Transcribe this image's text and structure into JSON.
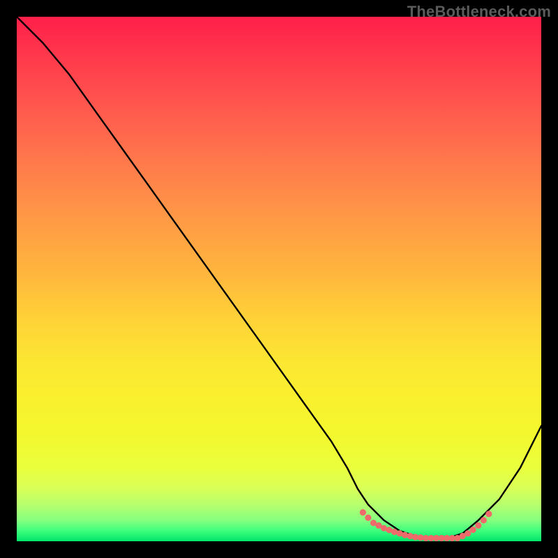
{
  "watermark": "TheBottleneck.com",
  "chart_data": {
    "type": "line",
    "title": "",
    "xlabel": "",
    "ylabel": "",
    "xlim": [
      0,
      100
    ],
    "ylim": [
      0,
      100
    ],
    "grid": false,
    "series": [
      {
        "name": "bottleneck-curve",
        "color": "#000000",
        "x": [
          0,
          5,
          10,
          15,
          20,
          25,
          30,
          35,
          40,
          45,
          50,
          55,
          60,
          63,
          65,
          67,
          70,
          73,
          76,
          79,
          82,
          85,
          88,
          92,
          96,
          100
        ],
        "y": [
          100,
          95,
          89,
          82,
          75,
          68,
          61,
          54,
          47,
          40,
          33,
          26,
          19,
          14,
          10,
          7,
          4,
          2,
          1,
          0.5,
          0.5,
          1.5,
          4,
          8,
          14,
          22
        ]
      },
      {
        "name": "optimal-range-marker",
        "color": "#ef6a6a",
        "style": "dotted-thick",
        "x": [
          66,
          68,
          70,
          72,
          74,
          76,
          78,
          80,
          82,
          84,
          85,
          86,
          87,
          88,
          89,
          90
        ],
        "y": [
          5.5,
          3.5,
          2.5,
          1.8,
          1.2,
          0.8,
          0.6,
          0.6,
          0.6,
          0.6,
          1.0,
          1.5,
          2.2,
          3.0,
          4.0,
          5.2
        ]
      }
    ],
    "gradient_stops": [
      {
        "pos": 0.0,
        "color": "#ff1f4a"
      },
      {
        "pos": 0.18,
        "color": "#ff5a4e"
      },
      {
        "pos": 0.38,
        "color": "#ff9846"
      },
      {
        "pos": 0.58,
        "color": "#ffd337"
      },
      {
        "pos": 0.73,
        "color": "#f9f02e"
      },
      {
        "pos": 0.9,
        "color": "#d9ff58"
      },
      {
        "pos": 1.0,
        "color": "#00e56a"
      }
    ]
  }
}
